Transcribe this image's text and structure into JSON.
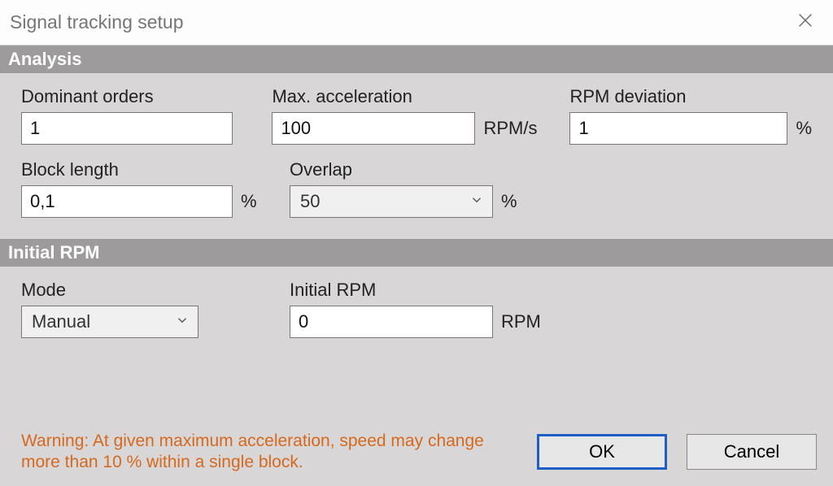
{
  "window": {
    "title": "Signal tracking setup"
  },
  "sections": {
    "analysis": {
      "header": "Analysis",
      "dominant_orders": {
        "label": "Dominant orders",
        "value": "1"
      },
      "max_accel": {
        "label": "Max. acceleration",
        "value": "100",
        "unit": "RPM/s"
      },
      "rpm_deviation": {
        "label": "RPM deviation",
        "value": "1",
        "unit": "%"
      },
      "block_length": {
        "label": "Block length",
        "value": "0,1",
        "unit": "%"
      },
      "overlap": {
        "label": "Overlap",
        "value": "50",
        "unit": "%"
      }
    },
    "initial_rpm": {
      "header": "Initial RPM",
      "mode": {
        "label": "Mode",
        "value": "Manual"
      },
      "initial_rpm": {
        "label": "Initial RPM",
        "value": "0",
        "unit": "RPM"
      }
    }
  },
  "footer": {
    "warning": "Warning: At given maximum acceleration, speed may change more than 10 % within a single block.",
    "ok": "OK",
    "cancel": "Cancel"
  }
}
